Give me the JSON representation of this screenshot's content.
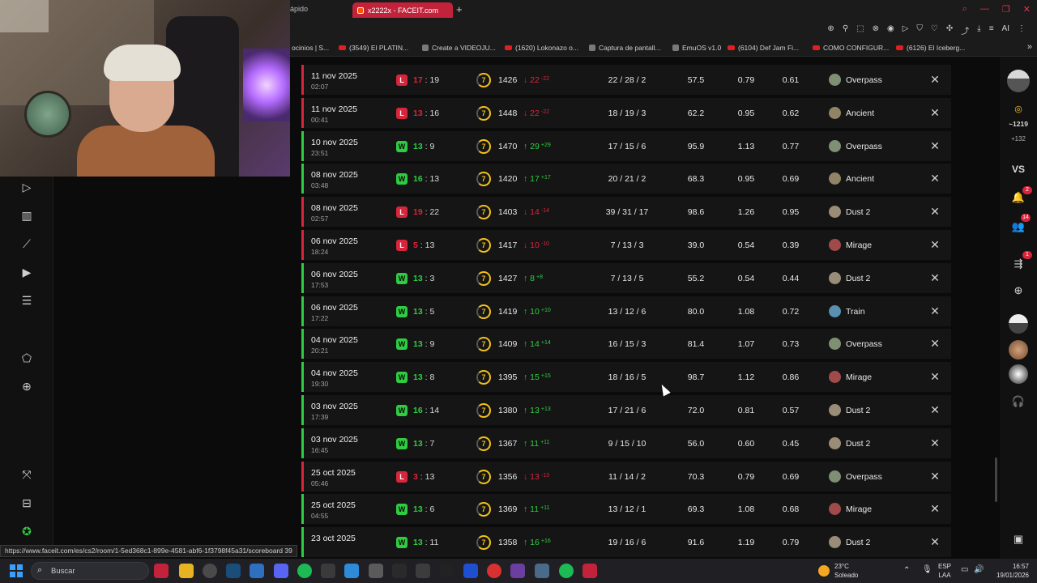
{
  "browser": {
    "partial_tab_label": "ápido",
    "active_tab_label": "x2222x - FACEIT.com",
    "new_tab": "+",
    "ai_label": "AI",
    "bookmarks": [
      {
        "label": "ocinios | S...",
        "icon": "generic"
      },
      {
        "label": "(3549) El PLATIN...",
        "icon": "youtube"
      },
      {
        "label": "Create a VIDEOJU...",
        "icon": "generic"
      },
      {
        "label": "(1620) Lokonazo o...",
        "icon": "youtube"
      },
      {
        "label": "Captura de pantall...",
        "icon": "generic"
      },
      {
        "label": "EmuOS v1.0",
        "icon": "generic"
      },
      {
        "label": "(6104) Def Jam Fi...",
        "icon": "youtube"
      },
      {
        "label": "COMO CONFIGUR...",
        "icon": "youtube"
      },
      {
        "label": "(6126) El Iceberg...",
        "icon": "youtube"
      }
    ],
    "status_url": "https://www.faceit.com/es/cs2/room/1-5ed368c1-899e-4581-abf6-1f3798f45a31/scoreboard",
    "status_url_tail": "39"
  },
  "matches": [
    {
      "result": "L",
      "date": "11 nov 2025",
      "time": "02:07",
      "score_mine": "17",
      "score_opp": "19",
      "level": "7",
      "elo": "1426",
      "delta": "22",
      "delta_small": "-22",
      "dir": "down",
      "kda": "22 / 28 / 2",
      "adr": "57.5",
      "kd": "0.79",
      "kr": "0.61",
      "map": "Overpass"
    },
    {
      "result": "L",
      "date": "11 nov 2025",
      "time": "00:41",
      "score_mine": "13",
      "score_opp": "16",
      "level": "7",
      "elo": "1448",
      "delta": "22",
      "delta_small": "-22",
      "dir": "down",
      "kda": "18 / 19 / 3",
      "adr": "62.2",
      "kd": "0.95",
      "kr": "0.62",
      "map": "Ancient"
    },
    {
      "result": "W",
      "date": "10 nov 2025",
      "time": "23:51",
      "score_mine": "13",
      "score_opp": "9",
      "level": "7",
      "elo": "1470",
      "delta": "29",
      "delta_small": "+29",
      "dir": "up",
      "kda": "17 / 15 / 6",
      "adr": "95.9",
      "kd": "1.13",
      "kr": "0.77",
      "map": "Overpass"
    },
    {
      "result": "W",
      "date": "08 nov 2025",
      "time": "03:48",
      "score_mine": "16",
      "score_opp": "13",
      "level": "7",
      "elo": "1420",
      "delta": "17",
      "delta_small": "+17",
      "dir": "up",
      "kda": "20 / 21 / 2",
      "adr": "68.3",
      "kd": "0.95",
      "kr": "0.69",
      "map": "Ancient"
    },
    {
      "result": "L",
      "date": "08 nov 2025",
      "time": "02:57",
      "score_mine": "19",
      "score_opp": "22",
      "level": "7",
      "elo": "1403",
      "delta": "14",
      "delta_small": "-14",
      "dir": "down",
      "kda": "39 / 31 / 17",
      "adr": "98.6",
      "kd": "1.26",
      "kr": "0.95",
      "map": "Dust 2"
    },
    {
      "result": "L",
      "date": "06 nov 2025",
      "time": "18:24",
      "score_mine": "5",
      "score_opp": "13",
      "level": "7",
      "elo": "1417",
      "delta": "10",
      "delta_small": "-10",
      "dir": "down",
      "kda": "7 / 13 / 3",
      "adr": "39.0",
      "kd": "0.54",
      "kr": "0.39",
      "map": "Mirage"
    },
    {
      "result": "W",
      "date": "06 nov 2025",
      "time": "17:53",
      "score_mine": "13",
      "score_opp": "3",
      "level": "7",
      "elo": "1427",
      "delta": "8",
      "delta_small": "+8",
      "dir": "up",
      "kda": "7 / 13 / 5",
      "adr": "55.2",
      "kd": "0.54",
      "kr": "0.44",
      "map": "Dust 2"
    },
    {
      "result": "W",
      "date": "06 nov 2025",
      "time": "17:22",
      "score_mine": "13",
      "score_opp": "5",
      "level": "7",
      "elo": "1419",
      "delta": "10",
      "delta_small": "+10",
      "dir": "up",
      "kda": "13 / 12 / 6",
      "adr": "80.0",
      "kd": "1.08",
      "kr": "0.72",
      "map": "Train"
    },
    {
      "result": "W",
      "date": "04 nov 2025",
      "time": "20:21",
      "score_mine": "13",
      "score_opp": "9",
      "level": "7",
      "elo": "1409",
      "delta": "14",
      "delta_small": "+14",
      "dir": "up",
      "kda": "16 / 15 / 3",
      "adr": "81.4",
      "kd": "1.07",
      "kr": "0.73",
      "map": "Overpass"
    },
    {
      "result": "W",
      "date": "04 nov 2025",
      "time": "19:30",
      "score_mine": "13",
      "score_opp": "8",
      "level": "7",
      "elo": "1395",
      "delta": "15",
      "delta_small": "+15",
      "dir": "up",
      "kda": "18 / 16 / 5",
      "adr": "98.7",
      "kd": "1.12",
      "kr": "0.86",
      "map": "Mirage"
    },
    {
      "result": "W",
      "date": "03 nov 2025",
      "time": "17:39",
      "score_mine": "16",
      "score_opp": "14",
      "level": "7",
      "elo": "1380",
      "delta": "13",
      "delta_small": "+13",
      "dir": "up",
      "kda": "17 / 21 / 6",
      "adr": "72.0",
      "kd": "0.81",
      "kr": "0.57",
      "map": "Dust 2"
    },
    {
      "result": "W",
      "date": "03 nov 2025",
      "time": "16:45",
      "score_mine": "13",
      "score_opp": "7",
      "level": "7",
      "elo": "1367",
      "delta": "11",
      "delta_small": "+11",
      "dir": "up",
      "kda": "9 / 15 / 10",
      "adr": "56.0",
      "kd": "0.60",
      "kr": "0.45",
      "map": "Dust 2"
    },
    {
      "result": "L",
      "date": "25 oct 2025",
      "time": "05:46",
      "score_mine": "3",
      "score_opp": "13",
      "level": "7",
      "elo": "1356",
      "delta": "13",
      "delta_small": "-13",
      "dir": "down",
      "kda": "11 / 14 / 2",
      "adr": "70.3",
      "kd": "0.79",
      "kr": "0.69",
      "map": "Overpass"
    },
    {
      "result": "W",
      "date": "25 oct 2025",
      "time": "04:55",
      "score_mine": "13",
      "score_opp": "6",
      "level": "7",
      "elo": "1369",
      "delta": "11",
      "delta_small": "+11",
      "dir": "up",
      "kda": "13 / 12 / 1",
      "adr": "69.3",
      "kd": "1.08",
      "kr": "0.68",
      "map": "Mirage"
    },
    {
      "result": "W",
      "date": "23 oct 2025",
      "time": "",
      "score_mine": "13",
      "score_opp": "11",
      "level": "7",
      "elo": "1358",
      "delta": "16",
      "delta_small": "+16",
      "dir": "up",
      "kda": "19 / 16 / 6",
      "adr": "91.6",
      "kd": "1.19",
      "kr": "0.79",
      "map": "Dust 2"
    }
  ],
  "right_sidebar": {
    "points": "~1219",
    "points_delta": "+132",
    "vs_label": "VS",
    "badge_notifications": "2",
    "badge_friends": "14",
    "badge_party": "1"
  },
  "taskbar": {
    "search_placeholder": "Buscar",
    "weather_temp": "23°C",
    "weather_desc": "Soleado",
    "lang_line1": "ESP",
    "lang_line2": "LAA",
    "clock_time": "16:57",
    "clock_date": "19/01/2026"
  },
  "colors": {
    "win": "#2ecc40",
    "loss": "#d9253c",
    "faceit_accent": "#ff5500",
    "level_ring": "#f3c21b"
  }
}
